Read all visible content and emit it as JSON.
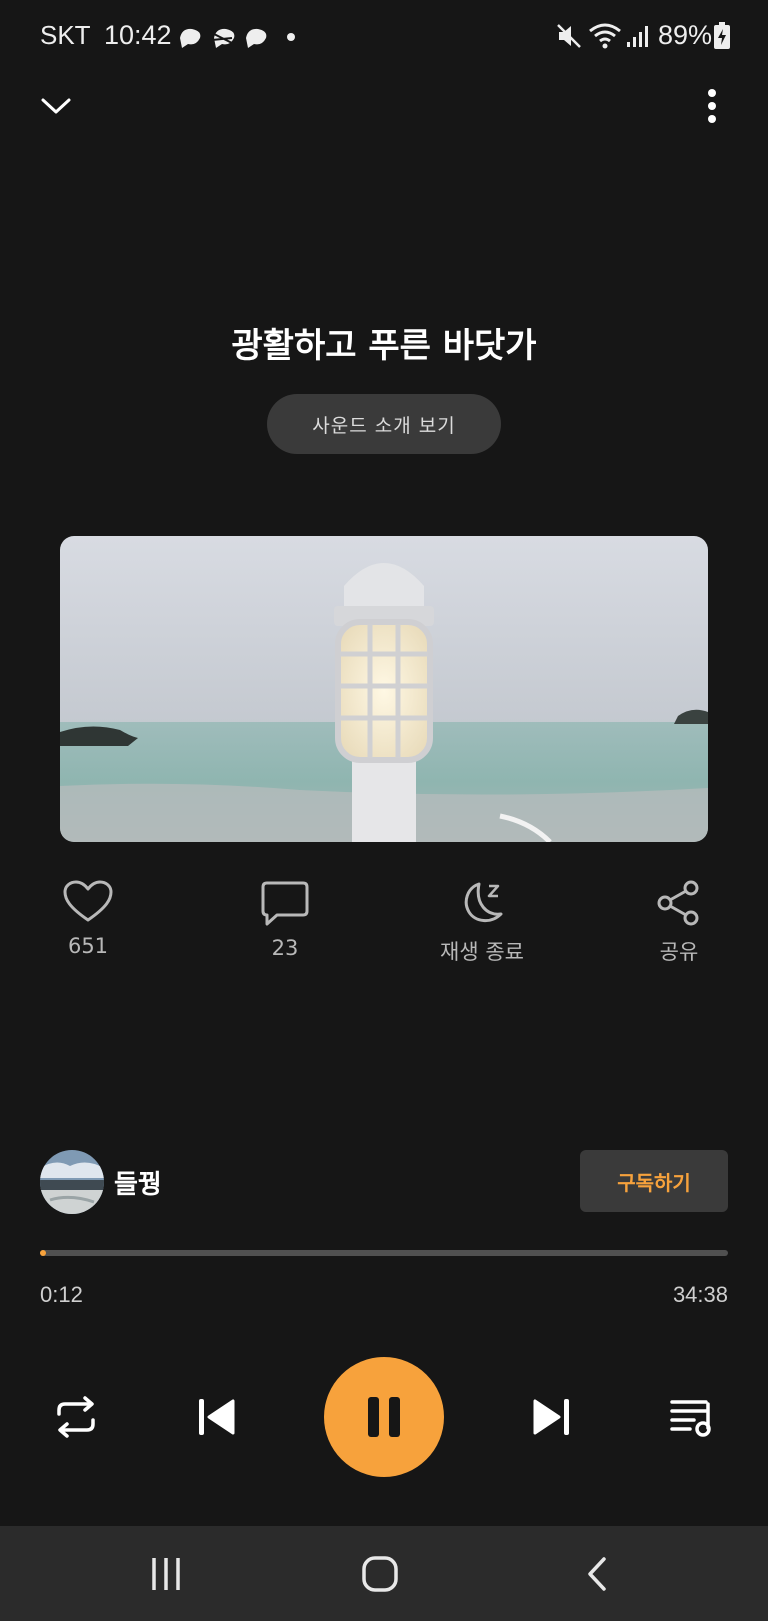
{
  "status_bar": {
    "carrier": "SKT",
    "time": "10:42",
    "battery": "89%",
    "icons": [
      "weather-icon",
      "weather-icon",
      "weather-icon",
      "dot-icon",
      "mute-icon",
      "wifi-icon",
      "signal-icon",
      "battery-charging-icon"
    ]
  },
  "header": {
    "collapse_icon": "chevron-down-icon",
    "more_icon": "more-vertical-icon"
  },
  "track": {
    "title": "광활하고 푸른 바닷가",
    "intro_button": "사운드 소개 보기"
  },
  "actions": {
    "like_count": "651",
    "comment_count": "23",
    "sleep_label": "재생 종료",
    "share_label": "공유"
  },
  "author": {
    "name": "들꿩",
    "subscribe_label": "구독하기"
  },
  "progress": {
    "elapsed": "0:12",
    "duration": "34:38",
    "fraction": 0.006
  },
  "controls": [
    "repeat-icon",
    "previous-icon",
    "pause-icon",
    "next-icon",
    "playlist-icon"
  ],
  "colors": {
    "accent": "#f7a23c",
    "background": "#161616",
    "button_bg": "#3a3a3a"
  }
}
